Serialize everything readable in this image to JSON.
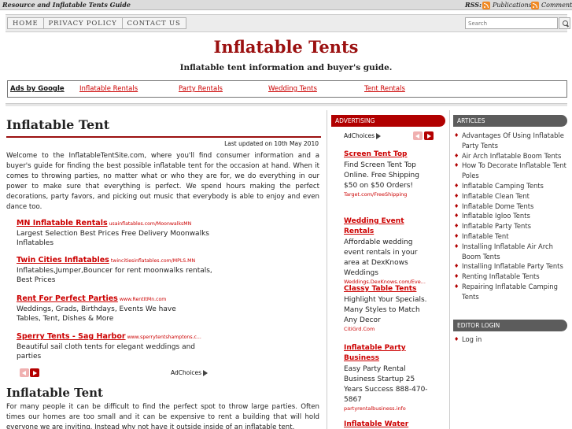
{
  "topbar": {
    "tagline": "Resource and Inflatable Tents Guide",
    "rss_label": "RSS:",
    "publications": "Publications",
    "comments": "Comments"
  },
  "nav": {
    "items": [
      "HOME",
      "PRIVACY POLICY",
      "CONTACT US"
    ],
    "search_placeholder": "Search"
  },
  "header": {
    "title": "Inflatable Tents",
    "subtitle": "Inflatable tent information and buyer's guide."
  },
  "adsbar": {
    "label": "Ads by Google",
    "links": [
      "Inflatable Rentals",
      "Party Rentals",
      "Wedding Tents",
      "Tent Rentals"
    ]
  },
  "main": {
    "title": "Inflatable Tent",
    "updated": "Last updated on 10th May 2010",
    "intro": "Welcome to the InflatableTentSite.com, where you'll find consumer information and a buyer's guide for finding the best possible inflatable tent for the occasion at hand. When it comes to throwing parties, no matter what or who they are for, we do everything in our power to make sure that everything is perfect. We spend hours making the perfect decorations, party favors, and picking out music that everybody is able to enjoy and even dance too.",
    "ads": [
      {
        "title": "MN Inflatable Rentals",
        "url": "usainflatables.com/MoonwalksMN",
        "desc": "Largest Selection Best Prices Free Delivery Moonwalks Inflatables"
      },
      {
        "title": "Twin Cities Inflatables",
        "url": "twincitiesinflatables.com/MPLS.MN",
        "desc": "Inflatables,Jumper,Bouncer for rent moonwalks rentals, Best Prices"
      },
      {
        "title": "Rent For Perfect Parties",
        "url": "www.RentItMn.com",
        "desc": "Weddings, Grads, Birthdays, Events We have Tables, Tent, Dishes & More"
      },
      {
        "title": "Sperry Tents - Sag Harbor",
        "url": "www.sperrytentshamptons.c...",
        "desc": "Beautiful sail cloth tents for elegant weddings and parties"
      }
    ],
    "adchoices": "AdChoices",
    "section_title": "Inflatable Tent",
    "section_text": "For many people it can be difficult to find the perfect spot to throw large parties. Often times our homes are too small and it can be expensive to rent a building that will hold everyone we are inviting. Instead why not have it outside inside of an inflatable tent."
  },
  "advertising": {
    "heading": "ADVERTISING",
    "adchoices": "AdChoices",
    "ads": [
      {
        "title": "Screen Tent Top",
        "desc": "Find Screen Tent Top Online. Free Shipping $50 on $50 Orders!",
        "url": "Target.com/FreeShipping"
      },
      {
        "title": "Wedding Event Rentals",
        "desc": "Affordable wedding event rentals in your area at DexKnows Weddings",
        "url": "Weddings.DexKnows.com/Eve..."
      },
      {
        "title": "Classy Table Tents",
        "desc": "Highlight Your Specials. Many Styles to Match Any Decor",
        "url": "CitiGrd.Com"
      },
      {
        "title": "Inflatable Party Business",
        "desc": "Easy Party Rental Business Startup 25 Years Success 888-470-5867",
        "url": "partyrentalbusiness.info"
      },
      {
        "title": "Inflatable Water Slides",
        "desc": "",
        "url": ""
      }
    ]
  },
  "articles": {
    "heading": "ARTICLES",
    "items": [
      "Advantages Of Using Inflatable Party Tents",
      "Air Arch Inflatable Boom Tents",
      "How To Decorate Inflatable Tent Poles",
      "Inflatable Camping Tents",
      "Inflatable Clean Tent",
      "Inflatable Dome Tents",
      "Inflatable Igloo Tents",
      "Inflatable Party Tents",
      "Inflatable Tent",
      "Installing Inflatable Air Arch Boom Tents",
      "Installing Inflatable Party Tents",
      "Renting Inflatable Tents",
      "Repairing Inflatable Camping Tents"
    ]
  },
  "editor": {
    "heading": "EDITOR LOGIN",
    "items": [
      "Log in"
    ]
  },
  "colors": {
    "accent": "#9b1010",
    "link": "#cc0000",
    "ad_heading": "#b10000",
    "panel_heading": "#5c5c5c"
  }
}
